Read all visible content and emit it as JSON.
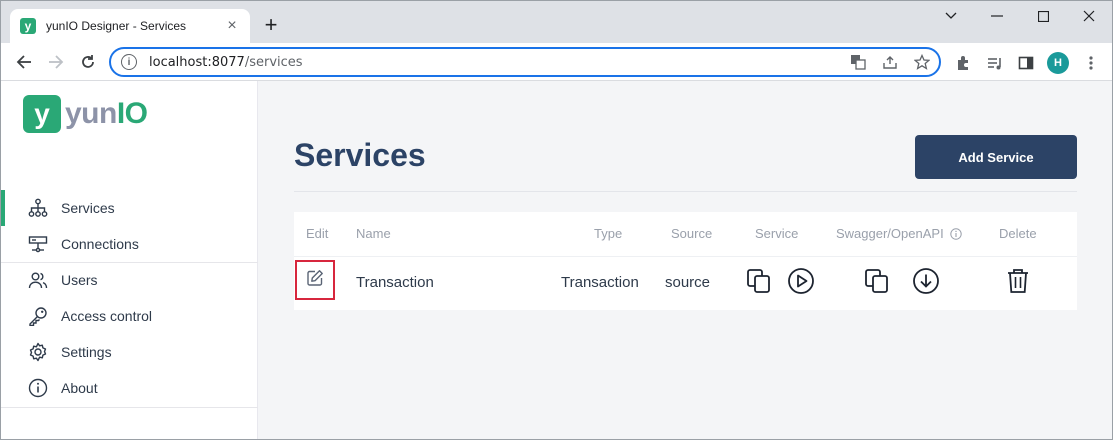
{
  "browser": {
    "tab_title": "yunIO Designer - Services",
    "tab_close": "×",
    "new_tab": "+",
    "url_host": "localhost:8077",
    "url_path": "/services",
    "profile_initial": "H",
    "favicon_letter": "y"
  },
  "sidebar": {
    "logo_mark": "y",
    "logo_text_a": "yun",
    "logo_text_b": "IO",
    "items": [
      {
        "label": "Services",
        "icon": "sitemap-icon",
        "active": true
      },
      {
        "label": "Connections",
        "icon": "connection-icon"
      },
      {
        "label": "Users",
        "icon": "users-icon"
      },
      {
        "label": "Access control",
        "icon": "key-icon"
      },
      {
        "label": "Settings",
        "icon": "gear-icon"
      },
      {
        "label": "About",
        "icon": "info-icon"
      }
    ]
  },
  "main": {
    "title": "Services",
    "add_button": "Add Service",
    "table": {
      "headers": {
        "edit": "Edit",
        "name": "Name",
        "type": "Type",
        "source": "Source",
        "service": "Service",
        "swagger": "Swagger/OpenAPI",
        "delete": "Delete"
      },
      "rows": [
        {
          "name": "Transaction",
          "type": "Transaction",
          "source": "source"
        }
      ]
    }
  },
  "colors": {
    "brand_green": "#2aa876",
    "primary_navy": "#2c4366",
    "highlight_red": "#d7263d"
  }
}
